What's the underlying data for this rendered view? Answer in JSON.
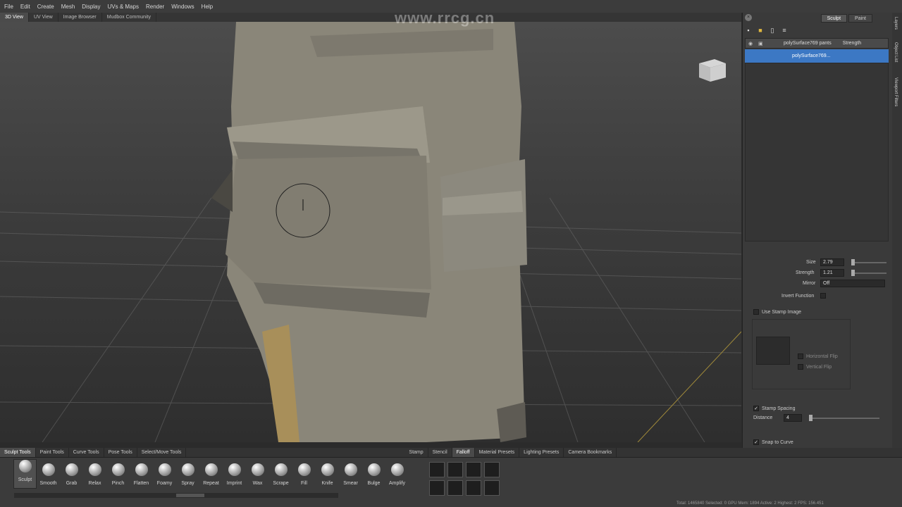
{
  "menu": [
    "File",
    "Edit",
    "Create",
    "Mesh",
    "Display",
    "UVs & Maps",
    "Render",
    "Windows",
    "Help"
  ],
  "view_tabs": [
    "3D View",
    "UV View",
    "Image Browser",
    "Mudbox Community"
  ],
  "right_tabs": [
    "Sculpt",
    "Paint"
  ],
  "side_tabs": [
    "Layers",
    "Object List",
    "Viewport Filters"
  ],
  "layers": {
    "col_name": "polySurface769 pants",
    "col_strength": "Strength",
    "row_name": "polySurface769..."
  },
  "props": {
    "size_label": "Size",
    "size_value": "2.79",
    "strength_label": "Strength",
    "strength_value": "1.21",
    "mirror_label": "Mirror",
    "mirror_value": "Off",
    "invert_label": "Invert Function",
    "use_stamp_label": "Use Stamp Image",
    "hflip_label": "Horizontal Flip",
    "vflip_label": "Vertical Flip",
    "stamp_spacing_label": "Stamp Spacing",
    "distance_label": "Distance",
    "distance_value": "4",
    "snap_label": "Snap to Curve"
  },
  "tray_tabs_left": [
    "Sculpt Tools",
    "Paint Tools",
    "Curve Tools",
    "Pose Tools",
    "Select/Move Tools"
  ],
  "tray_tabs_right": [
    "Stamp",
    "Stencil",
    "Falloff",
    "Material Presets",
    "Lighting Presets",
    "Camera Bookmarks"
  ],
  "tools": [
    "Sculpt",
    "Smooth",
    "Grab",
    "Relax",
    "Pinch",
    "Flatten",
    "Foamy",
    "Spray",
    "Repeat",
    "Imprint",
    "Wax",
    "Scrape",
    "Fill",
    "Knife",
    "Smear",
    "Bulge",
    "Amplify"
  ],
  "status": "Total: 1465840  Selected: 0 GPU Mem: 1894  Active: 2  Highest: 2  FPS: 156.451",
  "watermark": "www.rrcg.cn",
  "colors": {
    "accent": "#3c78c4",
    "panel": "#3a3a3a",
    "viewport": "#3f3f3f"
  }
}
